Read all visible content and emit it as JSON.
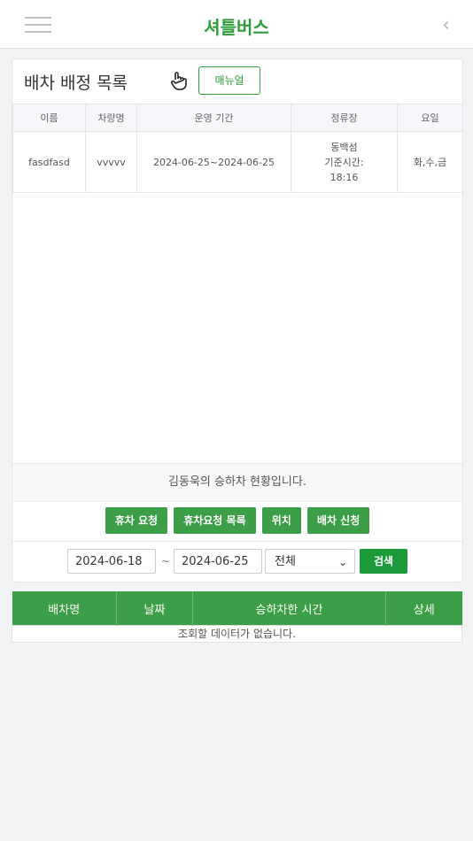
{
  "header": {
    "title": "셔틀버스",
    "menu_icon": "hamburger-icon",
    "back_icon": "chevron-left-icon"
  },
  "assignment": {
    "title": "배차 배정 목록",
    "manual_label": "매뉴얼",
    "columns": [
      "이름",
      "차량명",
      "운영 기간",
      "정류장",
      "요일"
    ],
    "rows": [
      {
        "name": "fasdfasd",
        "vehicle": "vvvvv",
        "period": "2024-06-25~2024-06-25",
        "stop_line1": "동백섬",
        "stop_line2": "기준시간:",
        "stop_line3": "18:16",
        "days": "화,수,금"
      }
    ]
  },
  "status_text": "김동욱의 승하차 현황입니다.",
  "buttons": {
    "rest_request": "휴차 요청",
    "rest_list": "휴차요청 목록",
    "location": "위치",
    "dispatch_apply": "배차 신청"
  },
  "filter": {
    "start_date": "2024-06-18",
    "separator": "~",
    "end_date": "2024-06-25",
    "selected": "전체",
    "search_label": "검색"
  },
  "records": {
    "columns": [
      "배차명",
      "날짜",
      "승하차한 시간",
      "상세"
    ],
    "empty_message": "조회할 데이터가 없습니다."
  },
  "colors": {
    "brand_green": "#2e9d3a",
    "button_green": "#3c9e46",
    "search_green": "#1c9a3a"
  }
}
